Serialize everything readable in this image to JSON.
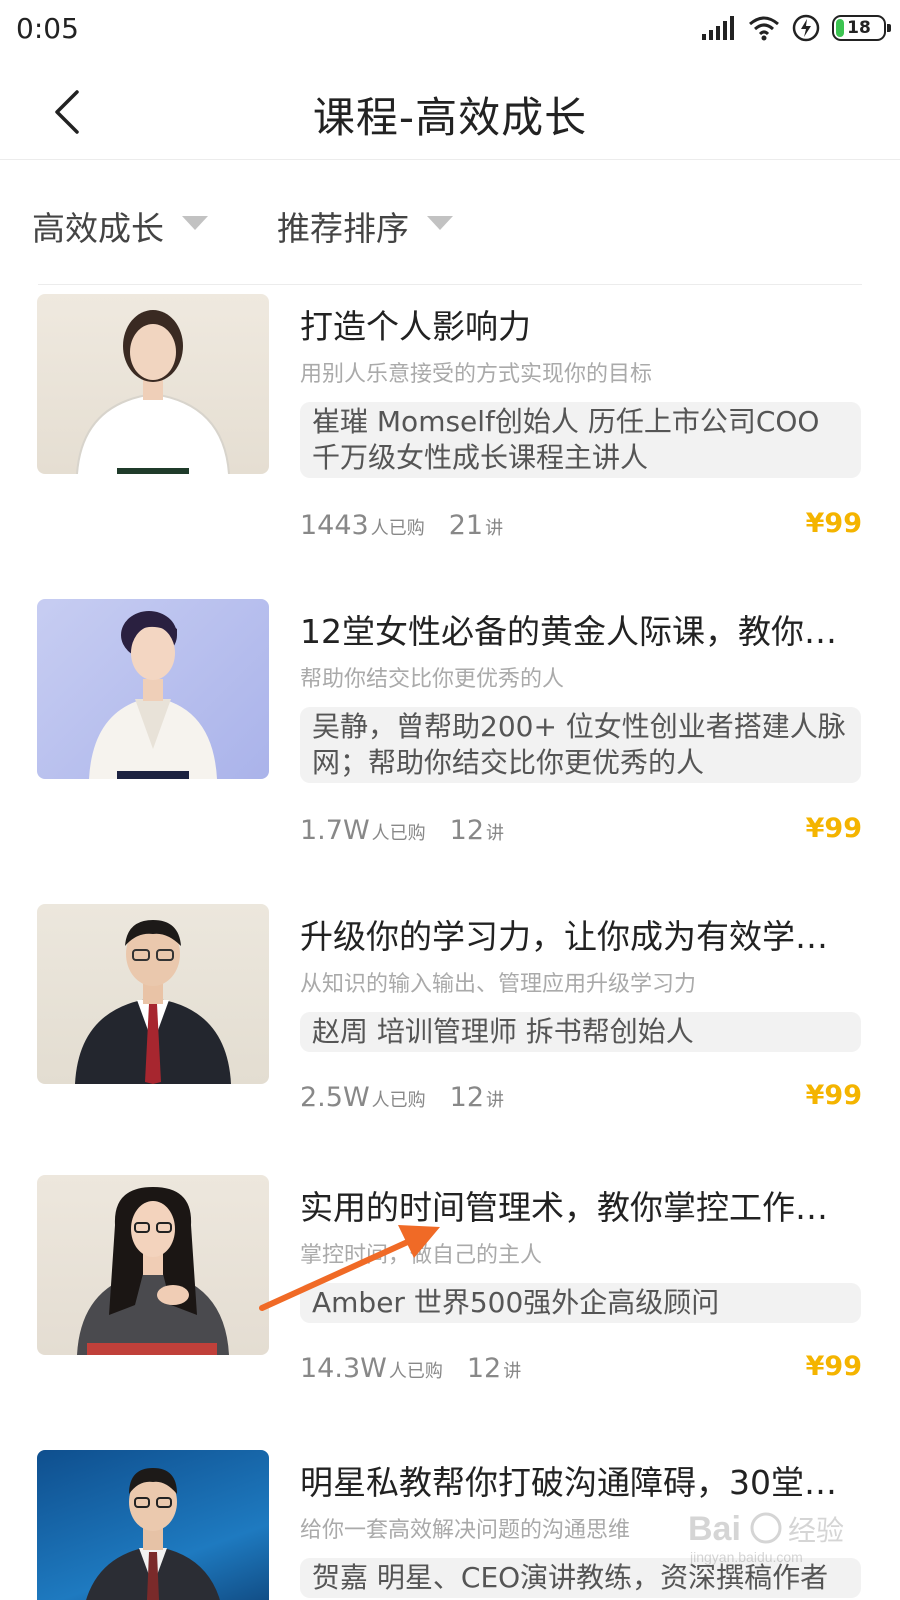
{
  "status_bar": {
    "time": "0:05",
    "battery": "18"
  },
  "nav": {
    "title": "课程-高效成长"
  },
  "filters": [
    {
      "label": "高效成长"
    },
    {
      "label": "推荐排序"
    }
  ],
  "courses": [
    {
      "title": "打造个人影响力",
      "subtitle": "用别人乐意接受的方式实现你的目标",
      "teacher": "崔璀 Momself创始人 历任上市公司COO 千万级女性成长课程主讲人",
      "buyers": "1443",
      "buyers_unit": "人已购",
      "lectures": "21",
      "lectures_unit": "讲",
      "price": "¥99"
    },
    {
      "title": "12堂女性必备的黄金人际课，教你…",
      "subtitle": "帮助你结交比你更优秀的人",
      "teacher": "吴静，曾帮助200+ 位女性创业者搭建人脉网；帮助你结交比你更优秀的人",
      "buyers": "1.7W",
      "buyers_unit": "人已购",
      "lectures": "12",
      "lectures_unit": "讲",
      "price": "¥99"
    },
    {
      "title": "升级你的学习力，让你成为有效学…",
      "subtitle": "从知识的输入输出、管理应用升级学习力",
      "teacher": "赵周 培训管理师 拆书帮创始人",
      "buyers": "2.5W",
      "buyers_unit": "人已购",
      "lectures": "12",
      "lectures_unit": "讲",
      "price": "¥99"
    },
    {
      "title": "实用的时间管理术，教你掌控工作…",
      "subtitle": "掌控时间，做自己的主人",
      "teacher": "Amber 世界500强外企高级顾问",
      "buyers": "14.3W",
      "buyers_unit": "人已购",
      "lectures": "12",
      "lectures_unit": "讲",
      "price": "¥99"
    },
    {
      "title": "明星私教帮你打破沟通障碍，30堂…",
      "subtitle": "给你一套高效解决问题的沟通思维",
      "teacher": "贺嘉 明星、CEO演讲教练，资深撰稿作者",
      "buyers": "",
      "buyers_unit": "",
      "lectures": "",
      "lectures_unit": "",
      "price": ""
    }
  ],
  "watermark": {
    "text": "Bai经验",
    "url": "jingyan.baidu.com"
  },
  "colors": {
    "price": "#f4b400",
    "annotation_arrow": "#f06a26"
  },
  "icons": [
    "signal-icon",
    "wifi-icon",
    "charging-icon",
    "battery-icon",
    "back-arrow-icon",
    "dropdown-triangle-icon"
  ]
}
